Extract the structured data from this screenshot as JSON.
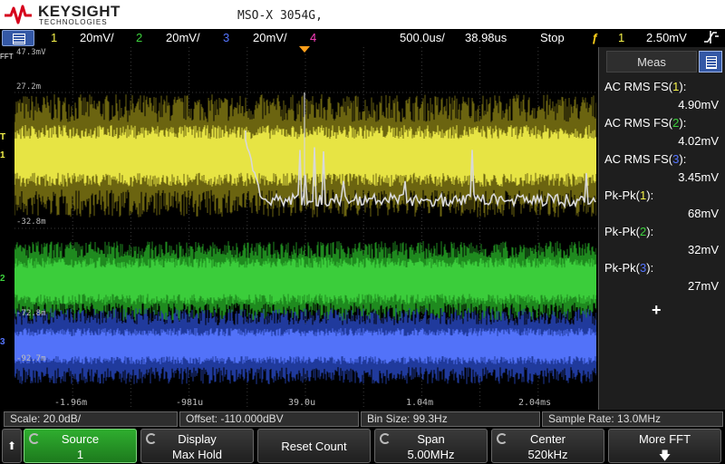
{
  "header": {
    "brand": "KEYSIGHT",
    "brand_sub": "TECHNOLOGIES",
    "model": "MSO-X 3054G,"
  },
  "status": {
    "ch1_num": "1",
    "ch1_scale": "20mV/",
    "ch2_num": "2",
    "ch2_scale": "20mV/",
    "ch3_num": "3",
    "ch3_scale": "20mV/",
    "ch4_num": "4",
    "timebase": "500.0us/",
    "delay": "38.98us",
    "run_state": "Stop",
    "trig_source": "1",
    "trig_level": "2.50mV",
    "trig_slope_icon": "slope-icon"
  },
  "graticule": {
    "fft_label": "FFT",
    "trig_label": "T",
    "y_labels": [
      "47.3mV",
      "27.2m",
      "-32.8m",
      "-72.8m",
      "-92.7m"
    ],
    "x_labels": [
      "-1.96m",
      "-981u",
      "39.0u",
      "1.04m",
      "2.04ms"
    ],
    "channel_markers": [
      "1",
      "2",
      "3"
    ],
    "colors": {
      "ch1": "#f5f24a",
      "ch2": "#3dd13d",
      "ch3": "#5575ff",
      "ch4": "#ff3fbf",
      "math": "#d8d8d8",
      "trigger": "#ff9f1a"
    }
  },
  "panel": {
    "title": "Meas",
    "measurements": [
      {
        "prefix": "AC RMS FS(",
        "ch": "1",
        "suffix": "):",
        "value": "4.90mV"
      },
      {
        "prefix": "AC RMS FS(",
        "ch": "2",
        "suffix": "):",
        "value": "4.02mV"
      },
      {
        "prefix": "AC RMS FS(",
        "ch": "3",
        "suffix": "):",
        "value": "3.45mV"
      },
      {
        "prefix": "Pk-Pk(",
        "ch": "1",
        "suffix": "):",
        "value": "68mV"
      },
      {
        "prefix": "Pk-Pk(",
        "ch": "2",
        "suffix": "):",
        "value": "32mV"
      },
      {
        "prefix": "Pk-Pk(",
        "ch": "3",
        "suffix": "):",
        "value": "27mV"
      }
    ],
    "add_label": "+"
  },
  "info": {
    "scale": "Scale: 20.0dB/",
    "offset": "Offset: -110.000dBV",
    "bin_size": "Bin Size: 99.3Hz",
    "sample_rate": "Sample Rate: 13.0MHz"
  },
  "softkeys": {
    "back_label": "⬆",
    "source": {
      "t1": "Source",
      "t2": "1"
    },
    "display": {
      "t1": "Display",
      "t2": "Max Hold"
    },
    "reset": "Reset Count",
    "span": {
      "t1": "Span",
      "t2": "5.00MHz"
    },
    "center": {
      "t1": "Center",
      "t2": "520kHz"
    },
    "more": {
      "t1": "More FFT",
      "t2": "🡇"
    }
  }
}
